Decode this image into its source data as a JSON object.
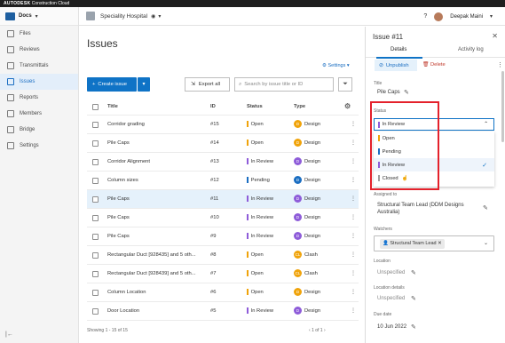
{
  "topbar": {
    "brand": "AUTODESK",
    "product": "Construction Cloud"
  },
  "sidebar": {
    "app_name": "Docs",
    "items": [
      {
        "label": "Files",
        "icon": "file-icon"
      },
      {
        "label": "Reviews",
        "icon": "review-icon"
      },
      {
        "label": "Transmittals",
        "icon": "transmittal-icon"
      },
      {
        "label": "Issues",
        "icon": "issue-icon",
        "active": true
      },
      {
        "label": "Reports",
        "icon": "report-icon"
      },
      {
        "label": "Members",
        "icon": "members-icon"
      },
      {
        "label": "Bridge",
        "icon": "bridge-icon"
      },
      {
        "label": "Settings",
        "icon": "settings-icon"
      }
    ]
  },
  "header": {
    "project": "Speciality Hospital",
    "user": "Deepak Maini",
    "help": "?"
  },
  "main": {
    "title": "Issues",
    "settings_label": "Settings",
    "create_label": "Create issue",
    "export_label": "Export all",
    "search_placeholder": "Search by issue title or ID",
    "columns": [
      "Title",
      "ID",
      "Status",
      "Type"
    ],
    "rows": [
      {
        "title": "Corridor grading",
        "id": "#15",
        "status": "Open",
        "status_color": "#f0a30a",
        "type": "Design",
        "badge": "D",
        "badge_color": "#f0a30a"
      },
      {
        "title": "Pile Caps",
        "id": "#14",
        "status": "Open",
        "status_color": "#f0a30a",
        "type": "Design",
        "badge": "D",
        "badge_color": "#f0a30a"
      },
      {
        "title": "Corridor Alignment",
        "id": "#13",
        "status": "In Review",
        "status_color": "#8e5cd9",
        "type": "Design",
        "badge": "D",
        "badge_color": "#8e5cd9"
      },
      {
        "title": "Column sizes",
        "id": "#12",
        "status": "Pending",
        "status_color": "#1b6ec2",
        "type": "Design",
        "badge": "D",
        "badge_color": "#1b6ec2"
      },
      {
        "title": "Pile Caps",
        "id": "#11",
        "status": "In Review",
        "status_color": "#8e5cd9",
        "type": "Design",
        "badge": "D",
        "badge_color": "#8e5cd9",
        "selected": true
      },
      {
        "title": "Pile Caps",
        "id": "#10",
        "status": "In Review",
        "status_color": "#8e5cd9",
        "type": "Design",
        "badge": "D",
        "badge_color": "#8e5cd9"
      },
      {
        "title": "Pile Caps",
        "id": "#9",
        "status": "In Review",
        "status_color": "#8e5cd9",
        "type": "Design",
        "badge": "D",
        "badge_color": "#8e5cd9"
      },
      {
        "title": "Rectangular Duct [928435] and 5 oth...",
        "id": "#8",
        "status": "Open",
        "status_color": "#f0a30a",
        "type": "Clash",
        "badge": "CL",
        "badge_color": "#f0a30a"
      },
      {
        "title": "Rectangular Duct [928439] and 5 oth...",
        "id": "#7",
        "status": "Open",
        "status_color": "#f0a30a",
        "type": "Clash",
        "badge": "CL",
        "badge_color": "#f0a30a"
      },
      {
        "title": "Column Location",
        "id": "#6",
        "status": "Open",
        "status_color": "#f0a30a",
        "type": "Design",
        "badge": "D",
        "badge_color": "#f0a30a"
      },
      {
        "title": "Door Location",
        "id": "#5",
        "status": "In Review",
        "status_color": "#8e5cd9",
        "type": "Design",
        "badge": "D",
        "badge_color": "#8e5cd9"
      }
    ],
    "footer": "Showing 1 - 15 of 15",
    "pagination": "1 of 1"
  },
  "panel": {
    "title": "Issue #11",
    "tabs": [
      "Details",
      "Activity log"
    ],
    "unpublish_label": "Unpublish",
    "delete_label": "Delete",
    "title_label": "Title",
    "title_value": "Pile Caps",
    "status_label": "Status",
    "status_value": "In Review",
    "status_options": [
      {
        "label": "Open",
        "color": "#f0a30a"
      },
      {
        "label": "Pending",
        "color": "#1b6ec2"
      },
      {
        "label": "In Review",
        "color": "#8e5cd9",
        "selected": true
      },
      {
        "label": "Closed",
        "color": "#9e9e9e"
      }
    ],
    "assigned_label": "Assigned to",
    "assigned_value": "Structural Team Lead (DDM Designs Australia)",
    "watchers_label": "Watchers",
    "watcher_chip": "Structural Team Lead",
    "location_label": "Location",
    "location_value": "Unspecified",
    "location_details_label": "Location details",
    "location_details_value": "Unspecified",
    "due_label": "Due date",
    "due_value": "10 Jun 2022"
  },
  "colors": {
    "accent": "#0f73c6",
    "highlight": "#e4212b"
  }
}
